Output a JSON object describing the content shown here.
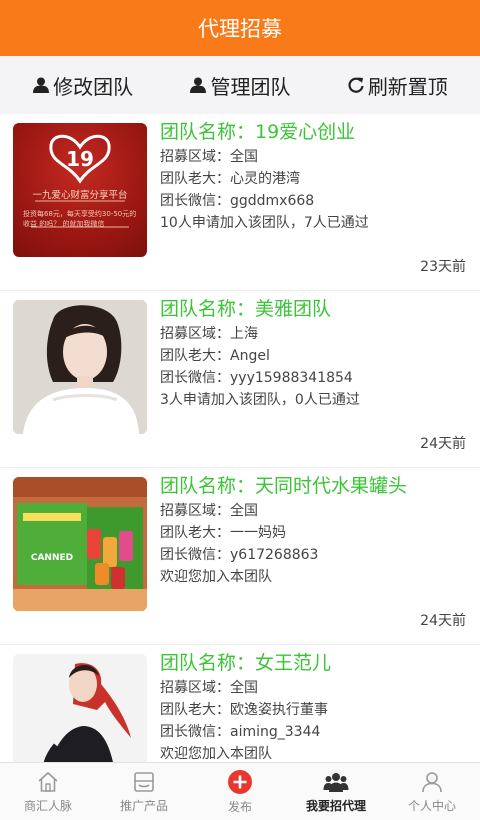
{
  "header": {
    "title": "代理招募"
  },
  "toolbar": {
    "edit_label": "修改团队",
    "manage_label": "管理团队",
    "refresh_label": "刷新置顶"
  },
  "cards": [
    {
      "name": "团队名称：19爱心创业",
      "region": "招募区域：全国",
      "boss": "团队老大：心灵的港湾",
      "wechat": "团长微信：ggddmx668",
      "status": "10人申请加入该团队，7人已通过",
      "ago": "23天前",
      "thumb_logo": "19",
      "thumb_tagline": "一九爱心财富分享平台",
      "thumb_small": "投资每68元，每天享受约30-50元的收益 的吗？ 的就加我微信"
    },
    {
      "name": "团队名称：美雅团队",
      "region": "招募区域：上海",
      "boss": "团队老大：Angel",
      "wechat": "团长微信：yyy15988341854",
      "status": "3人申请加入该团队，0人已通过",
      "ago": "24天前"
    },
    {
      "name": "团队名称：天同时代水果罐头",
      "region": "招募区域：全国",
      "boss": "团队老大：一一妈妈",
      "wechat": "团长微信：y617268863",
      "status": "欢迎您加入本团队",
      "ago": "24天前",
      "thumb_box_text": "CANNED"
    },
    {
      "name": "团队名称：女王范儿",
      "region": "招募区域：全国",
      "boss": "团队老大：欧逸姿执行董事",
      "wechat": "团长微信：aiming_3344",
      "status": "欢迎您加入本团队"
    }
  ],
  "tabbar": {
    "tabs": [
      {
        "label": "商汇人脉",
        "icon": "home-icon"
      },
      {
        "label": "推广产品",
        "icon": "shop-icon"
      },
      {
        "label": "发布",
        "icon": "plus-icon"
      },
      {
        "label": "我要招代理",
        "icon": "group-icon"
      },
      {
        "label": "个人中心",
        "icon": "person-icon"
      }
    ],
    "active_index": 3
  },
  "colors": {
    "header": "#f97a18",
    "team_name": "#3cc437",
    "publish_button": "#e8372f"
  }
}
